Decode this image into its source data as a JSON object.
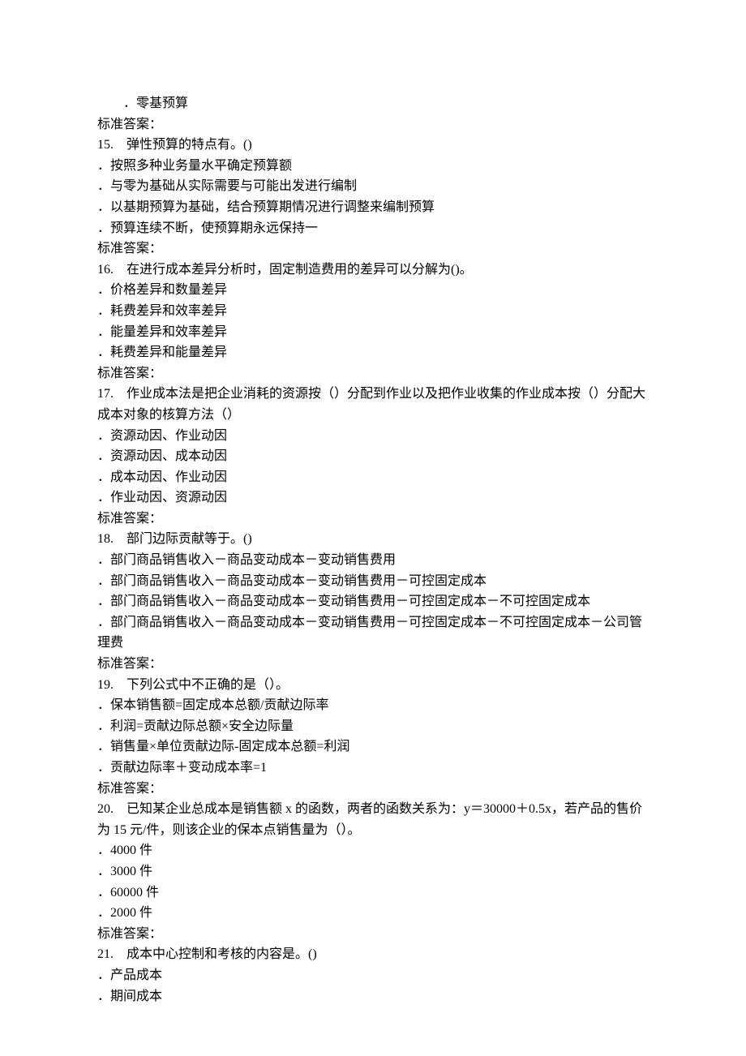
{
  "stray_option": "．零基预算",
  "answer_label": "标准答案：",
  "questions": [
    {
      "num": "15.",
      "text": "弹性预算的特点有。()",
      "options": [
        "．按照多种业务量水平确定预算额",
        "．与零为基础从实际需要与可能出发进行编制",
        "．以基期预算为基础，结合预算期情况进行调整来编制预算",
        "．预算连续不断，使预算期永远保持一"
      ]
    },
    {
      "num": "16.",
      "text": "在进行成本差异分析时，固定制造费用的差异可以分解为()。",
      "options": [
        "．价格差异和数量差异",
        "．耗费差异和效率差异",
        "．能量差异和效率差异",
        "．耗费差异和能量差异"
      ]
    },
    {
      "num": "17.",
      "text": "作业成本法是把企业消耗的资源按（）分配到作业以及把作业收集的作业成本按（）分配大成本对象的核算方法（）",
      "options": [
        "．资源动因、作业动因",
        "．资源动因、成本动因",
        "．成本动因、作业动因",
        "．作业动因、资源动因"
      ]
    },
    {
      "num": "18.",
      "text": "部门边际贡献等于。()",
      "options": [
        "．部门商品销售收入－商品变动成本－变动销售费用",
        "．部门商品销售收入－商品变动成本－变动销售费用－可控固定成本",
        "．部门商品销售收入－商品变动成本－变动销售费用－可控固定成本－不可控固定成本",
        "．部门商品销售收入－商品变动成本－变动销售费用－可控固定成本－不可控固定成本－公司管理费"
      ]
    },
    {
      "num": "19.",
      "text": "下列公式中不正确的是（）。",
      "options": [
        "．保本销售额=固定成本总额/贡献边际率",
        "．利润=贡献边际总额×安全边际量",
        "．销售量×单位贡献边际-固定成本总额=利润",
        "．贡献边际率＋变动成本率=1"
      ]
    },
    {
      "num": "20.",
      "text": "已知某企业总成本是销售额 x 的函数，两者的函数关系为：y＝30000＋0.5x，若产品的售价为 15 元/件，则该企业的保本点销售量为（）。",
      "options": [
        "．4000 件",
        "．3000 件",
        "．60000 件",
        "．2000 件"
      ]
    },
    {
      "num": "21.",
      "text": "成本中心控制和考核的内容是。()",
      "options": [
        "．产品成本",
        "．期间成本"
      ],
      "no_answer": true
    }
  ]
}
